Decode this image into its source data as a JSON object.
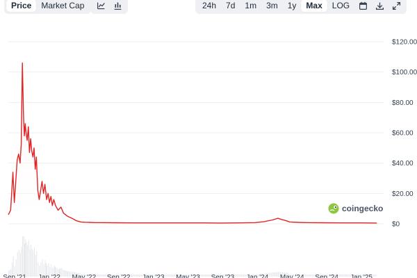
{
  "toolbar": {
    "metric_tabs": [
      "Price",
      "Market Cap"
    ],
    "active_metric": "Price",
    "chart_type_icons": [
      "line-chart-icon",
      "candlestick-chart-icon"
    ],
    "range_tabs": [
      "24h",
      "7d",
      "1m",
      "3m",
      "1y",
      "Max",
      "LOG"
    ],
    "active_range": "Max",
    "action_icons": [
      "calendar-icon",
      "download-icon",
      "expand-icon"
    ]
  },
  "brand": {
    "name": "coingecko"
  },
  "colors": {
    "line": "#e02424",
    "fill_top": "#fdecec",
    "grid": "#eeeeee",
    "volume": "#e5e7eb"
  },
  "chart_data": {
    "type": "line",
    "title": "",
    "xlabel": "",
    "ylabel": "",
    "y_unit": "$",
    "ylim": [
      0,
      120
    ],
    "y_ticks": [
      "$120.00",
      "$100.00",
      "$80.00",
      "$60.00",
      "$40.00",
      "$20.00",
      "$0"
    ],
    "x_ticks": [
      "Sep '21",
      "Jan '22",
      "May '22",
      "Sep '22",
      "Jan '23",
      "May '23",
      "Sep '23",
      "Jan '24",
      "May '24",
      "Sep '24",
      "Jan '25"
    ],
    "grid": true,
    "series": [
      {
        "x": [
          "2021-08-20",
          "2021-08-28",
          "2021-09-05",
          "2021-09-10",
          "2021-09-15",
          "2021-09-20",
          "2021-09-25",
          "2021-09-30",
          "2021-10-04",
          "2021-10-08",
          "2021-10-12",
          "2021-10-15",
          "2021-10-18",
          "2021-10-21",
          "2021-10-25",
          "2021-10-29",
          "2021-11-02",
          "2021-11-06",
          "2021-11-10",
          "2021-11-14",
          "2021-11-18",
          "2021-11-22",
          "2021-11-26",
          "2021-12-01",
          "2021-12-06",
          "2021-12-11",
          "2021-12-16",
          "2021-12-21",
          "2021-12-26",
          "2022-01-01",
          "2022-01-06",
          "2022-01-11",
          "2022-01-16",
          "2022-01-21",
          "2022-01-26",
          "2022-02-01",
          "2022-02-10",
          "2022-02-20",
          "2022-03-01",
          "2022-03-15",
          "2022-04-01",
          "2022-04-15",
          "2022-05-01",
          "2022-05-15",
          "2022-06-01",
          "2022-06-20",
          "2022-07-15",
          "2022-09-01",
          "2022-11-01",
          "2023-01-01",
          "2023-03-01",
          "2023-05-01",
          "2023-07-01",
          "2023-09-01",
          "2023-11-01",
          "2024-01-01",
          "2024-02-01",
          "2024-03-01",
          "2024-03-20",
          "2024-04-01",
          "2024-04-15",
          "2024-05-01",
          "2024-06-01",
          "2024-07-01",
          "2024-09-01",
          "2024-11-01",
          "2025-01-01",
          "2025-03-01"
        ],
        "y": [
          6,
          9,
          34,
          14,
          28,
          42,
          46,
          40,
          52,
          106,
          72,
          58,
          66,
          60,
          55,
          64,
          47,
          56,
          48,
          44,
          50,
          36,
          44,
          22,
          16,
          22,
          28,
          20,
          26,
          16,
          20,
          14,
          18,
          12,
          16,
          12,
          9,
          11,
          7,
          5,
          3.5,
          2,
          1.2,
          1,
          0.9,
          0.8,
          0.8,
          0.7,
          0.6,
          0.6,
          0.6,
          0.6,
          0.6,
          0.5,
          0.6,
          0.8,
          1.4,
          2.5,
          3.6,
          2.9,
          2.2,
          1.2,
          0.9,
          0.8,
          0.7,
          0.6,
          0.6,
          0.5
        ]
      }
    ]
  }
}
